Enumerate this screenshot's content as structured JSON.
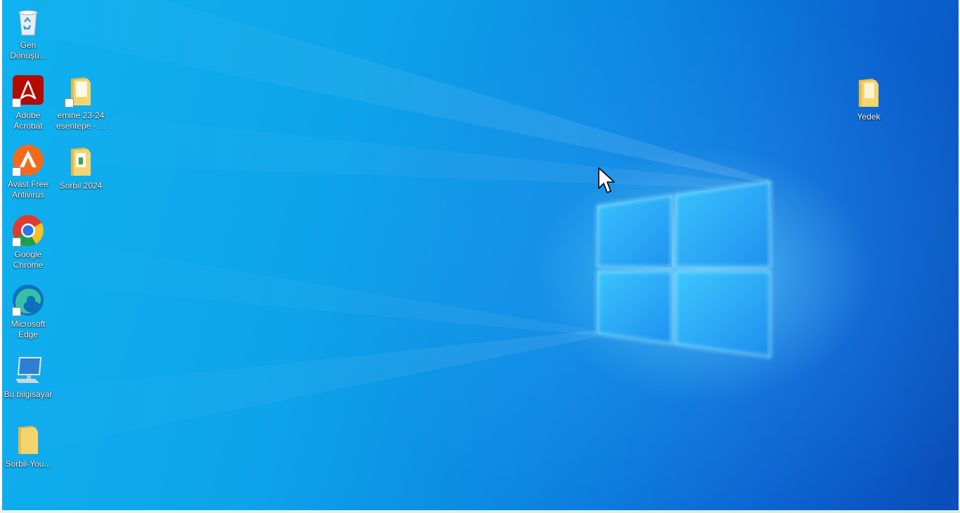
{
  "desktop": {
    "icons": [
      {
        "id": "recycle-bin",
        "label": "Geri Dönüşü...",
        "icon": "recycle-bin-icon"
      },
      {
        "id": "adobe-acrobat",
        "label": "Adobe Acrobat",
        "icon": "adobe-acrobat-icon"
      },
      {
        "id": "emine-folder",
        "label": "emine 23-24 esentepe - ...",
        "icon": "folder-icon"
      },
      {
        "id": "avast",
        "label": "Avast Free Antivirus",
        "icon": "avast-icon"
      },
      {
        "id": "sorbil-2024",
        "label": "Sorbil 2024",
        "icon": "folder-document-icon"
      },
      {
        "id": "chrome",
        "label": "Google Chrome",
        "icon": "chrome-icon"
      },
      {
        "id": "edge",
        "label": "Microsoft Edge",
        "icon": "edge-icon"
      },
      {
        "id": "this-pc",
        "label": "Bu bilgisayar",
        "icon": "computer-icon"
      },
      {
        "id": "sorbil-you",
        "label": "Sorbil-You...",
        "icon": "folder-icon"
      },
      {
        "id": "yedek",
        "label": "Yedek",
        "icon": "folder-icon"
      }
    ]
  },
  "colors": {
    "wallpaper_light": "#0fb2ef",
    "wallpaper_dark": "#0a4db9",
    "folder_yellow": "#f5d46e",
    "acrobat_red": "#b30b00",
    "avast_orange": "#f26b1d"
  }
}
